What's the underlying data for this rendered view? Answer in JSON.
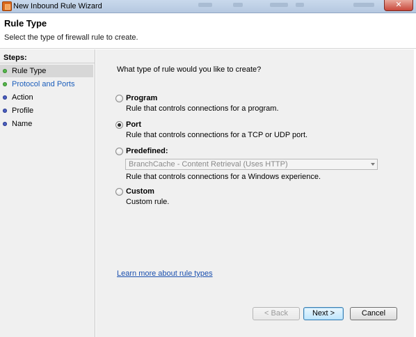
{
  "window": {
    "title": "New Inbound Rule Wizard",
    "close_label": "✕"
  },
  "header": {
    "title": "Rule Type",
    "subtitle": "Select the type of firewall rule to create."
  },
  "steps": {
    "label": "Steps:",
    "items": [
      {
        "label": "Rule Type",
        "state": "current",
        "dot_color": "#55b84b"
      },
      {
        "label": "Protocol and Ports",
        "state": "link",
        "dot_color": "#55b84b"
      },
      {
        "label": "Action",
        "state": "pending",
        "dot_color": "#4b5fc2"
      },
      {
        "label": "Profile",
        "state": "pending",
        "dot_color": "#4b5fc2"
      },
      {
        "label": "Name",
        "state": "pending",
        "dot_color": "#4b5fc2"
      }
    ]
  },
  "main": {
    "question": "What type of rule would you like to create?",
    "options": [
      {
        "title": "Program",
        "description": "Rule that controls connections for a program.",
        "checked": false
      },
      {
        "title": "Port",
        "description": "Rule that controls connections for a TCP or UDP port.",
        "checked": true
      },
      {
        "title": "Predefined:",
        "description": "Rule that controls connections for a Windows experience.",
        "checked": false
      },
      {
        "title": "Custom",
        "description": "Custom rule.",
        "checked": false
      }
    ],
    "predefined_select": {
      "value": "BranchCache - Content Retrieval (Uses HTTP)",
      "enabled": false
    },
    "learn_more_link": "Learn more about rule types"
  },
  "buttons": {
    "back": "< Back",
    "next": "Next >",
    "cancel": "Cancel"
  },
  "icons": {
    "window": "firewall-app-icon",
    "select_arrow": "chevron-down-icon"
  },
  "colors": {
    "title_bar": "#c9d9ec",
    "step_done": "#55b84b",
    "step_pending": "#4b5fc2",
    "link": "#1a5dbb",
    "pane_background": "#f0f0f0"
  }
}
